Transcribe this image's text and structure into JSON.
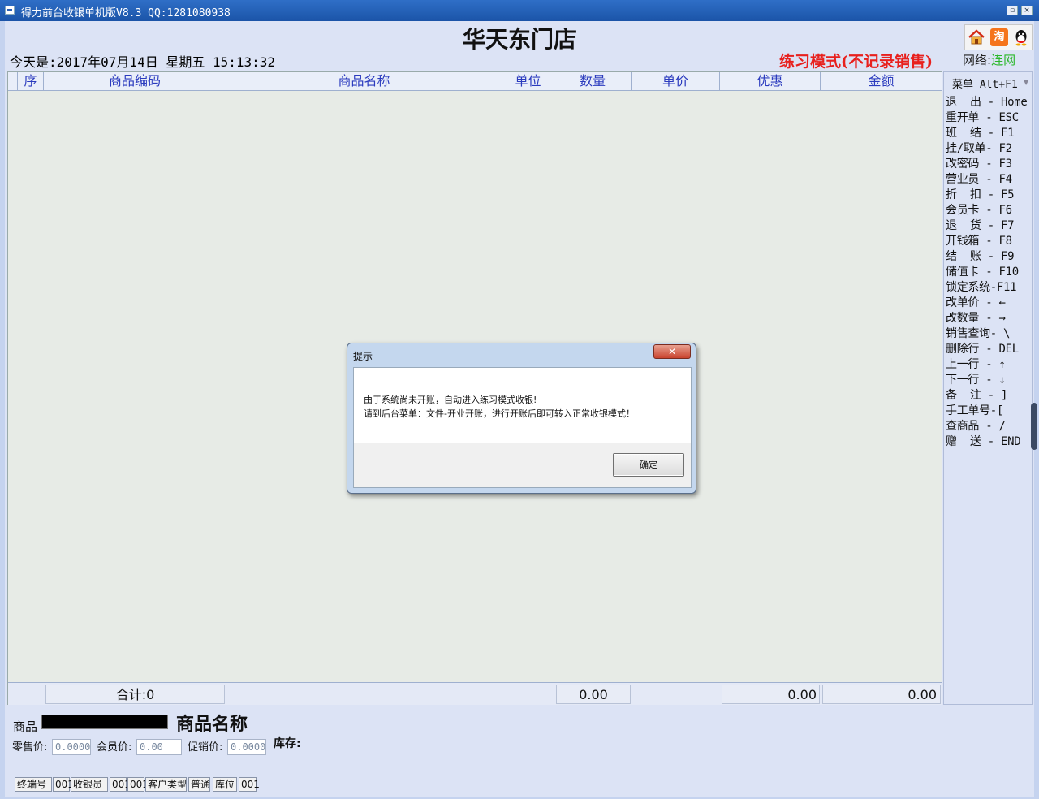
{
  "window": {
    "title": "得力前台收银单机版V8.3 QQ:1281080938",
    "restore_glyph": "▫",
    "close_glyph": "×"
  },
  "header": {
    "store_name": "华天东门店",
    "date_line": "今天是:2017年07月14日  星期五 15:13:32",
    "mode": "练习模式(不记录销售)",
    "network_label": "网络:",
    "network_status": "连网",
    "taobao_icon_text": "淘"
  },
  "grid": {
    "columns": [
      "序",
      "商品编码",
      "商品名称",
      "单位",
      "数量",
      "单价",
      "优惠",
      "金额"
    ],
    "footer": {
      "total_label": "合计:0",
      "qty_total": "0.00",
      "discount_total": "0.00",
      "amount_total": "0.00"
    }
  },
  "keys": {
    "menu": "菜单 Alt+F1",
    "items": [
      "退  出 - Home",
      "重开单 - ESC",
      "班  结 - F1",
      "挂/取单- F2",
      "改密码 - F3",
      "营业员 - F4",
      "折  扣 - F5",
      "会员卡 - F6",
      "退  货 - F7",
      "开钱箱 - F8",
      "结  账 - F9",
      "储值卡 - F10",
      "锁定系统-F11",
      "改单价 - ←",
      "改数量 - →",
      "销售查询- \\",
      "删除行 - DEL",
      "上一行 - ↑",
      "下一行 - ↓",
      "备  注 - ]",
      "手工单号-[",
      "查商品 - /",
      "赠  送 - END"
    ]
  },
  "product": {
    "label": "商品",
    "name": "商品名称",
    "retail_label": "零售价:",
    "retail_value": "0.0000",
    "member_label": "会员价:",
    "member_value": "0.00",
    "promo_label": "促销价:",
    "promo_value": "0.0000",
    "stock_label": "库存:"
  },
  "status": {
    "terminal_label": "终端号",
    "terminal_value": "001",
    "cashier_label": "收银员",
    "cashier_id": "001",
    "cashier_name": "001",
    "customer_type_label": "客户类型",
    "customer_type_value": "普通",
    "location_label": "库位",
    "location_value": "001"
  },
  "dialog": {
    "title": "提示",
    "message_line1": "由于系统尚未开账，自动进入练习模式收银!",
    "message_line2": "请到后台菜单：文件-开业开账，进行开账后即可转入正常收银模式！",
    "ok_label": "确定",
    "close_glyph": "✕"
  }
}
